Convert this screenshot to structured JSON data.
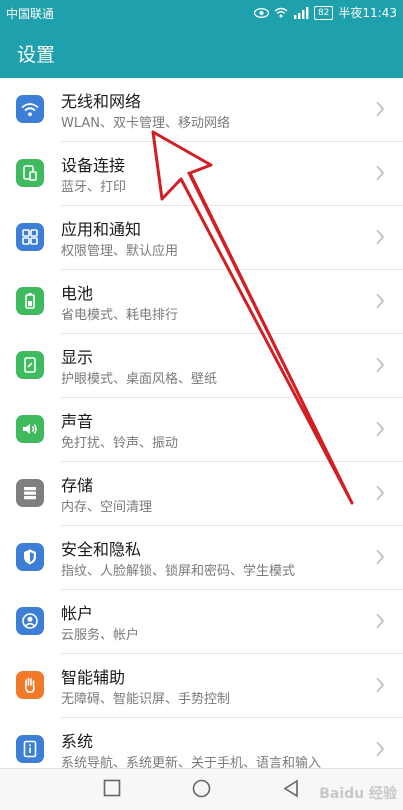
{
  "status": {
    "carrier": "中国联通",
    "battery": "82",
    "time": "半夜11:43"
  },
  "header": {
    "title": "设置"
  },
  "items": [
    {
      "title": "无线和网络",
      "subtitle": "WLAN、双卡管理、移动网络",
      "icon": "wifi-icon",
      "color": "#3d7fd6"
    },
    {
      "title": "设备连接",
      "subtitle": "蓝牙、打印",
      "icon": "device-connect-icon",
      "color": "#3fba5e"
    },
    {
      "title": "应用和通知",
      "subtitle": "权限管理、默认应用",
      "icon": "apps-icon",
      "color": "#3d7fd6"
    },
    {
      "title": "电池",
      "subtitle": "省电模式、耗电排行",
      "icon": "battery-icon",
      "color": "#3fba5e"
    },
    {
      "title": "显示",
      "subtitle": "护眼模式、桌面风格、壁纸",
      "icon": "display-icon",
      "color": "#3fba5e"
    },
    {
      "title": "声音",
      "subtitle": "免打扰、铃声、振动",
      "icon": "sound-icon",
      "color": "#3fba5e"
    },
    {
      "title": "存储",
      "subtitle": "内存、空间清理",
      "icon": "storage-icon",
      "color": "#7f7f7f"
    },
    {
      "title": "安全和隐私",
      "subtitle": "指纹、人脸解锁、锁屏和密码、学生模式",
      "icon": "shield-icon",
      "color": "#3d7fd6"
    },
    {
      "title": "帐户",
      "subtitle": "云服务、帐户",
      "icon": "account-icon",
      "color": "#3d7fd6"
    },
    {
      "title": "智能辅助",
      "subtitle": "无障碍、智能识屏、手势控制",
      "icon": "hand-icon",
      "color": "#f07a2a"
    },
    {
      "title": "系统",
      "subtitle": "系统导航、系统更新、关于手机、语言和输入",
      "icon": "system-info-icon",
      "color": "#3d7fd6"
    }
  ],
  "watermark": "Baidu 经验"
}
